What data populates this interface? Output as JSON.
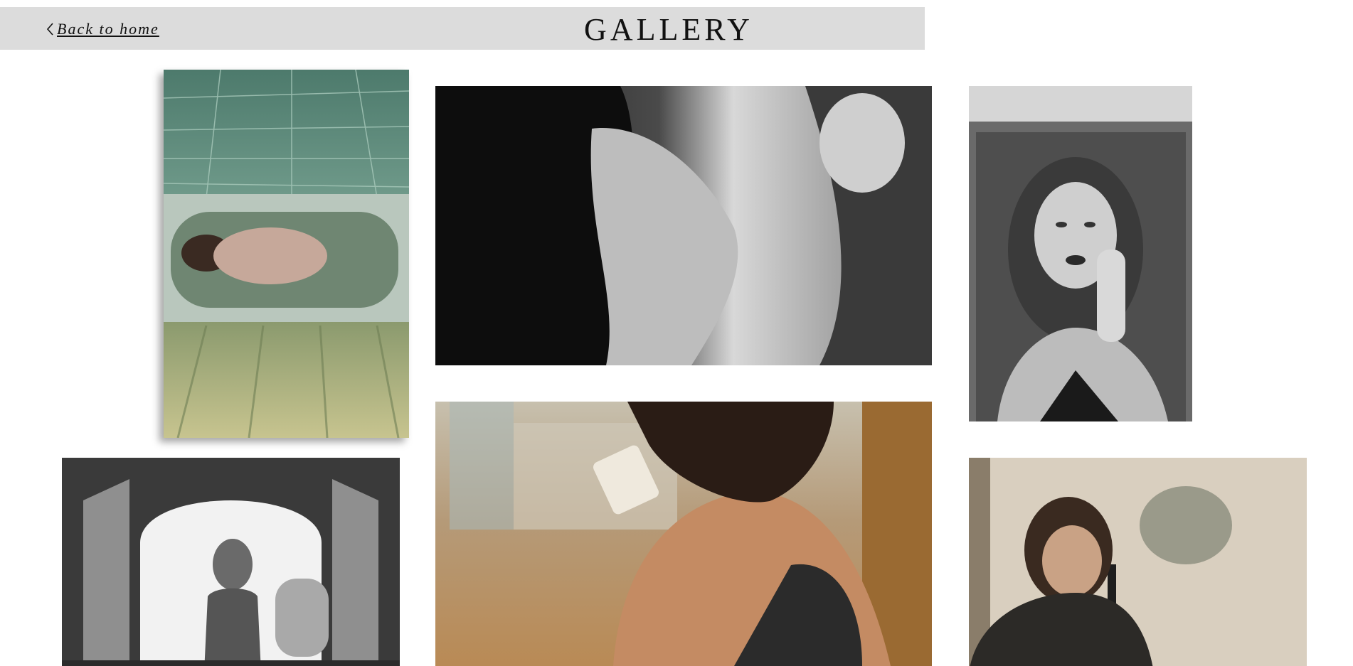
{
  "header": {
    "back_label": "Back to home",
    "title": "GALLERY"
  },
  "colors": {
    "header_bg": "#dcdcdc",
    "page_bg": "#ffffff",
    "text": "#111111"
  },
  "icons": {
    "back": "chevron-left-icon"
  },
  "photos": [
    {
      "id": "bathtub-photo",
      "tone": "green"
    },
    {
      "id": "profile-bw-photo",
      "tone": "monochrome"
    },
    {
      "id": "mirror-portrait-photo",
      "tone": "monochrome"
    },
    {
      "id": "window-arch-photo",
      "tone": "monochrome"
    },
    {
      "id": "coffee-sunlight-photo",
      "tone": "warm"
    },
    {
      "id": "microphone-photo",
      "tone": "warm-dark"
    }
  ]
}
